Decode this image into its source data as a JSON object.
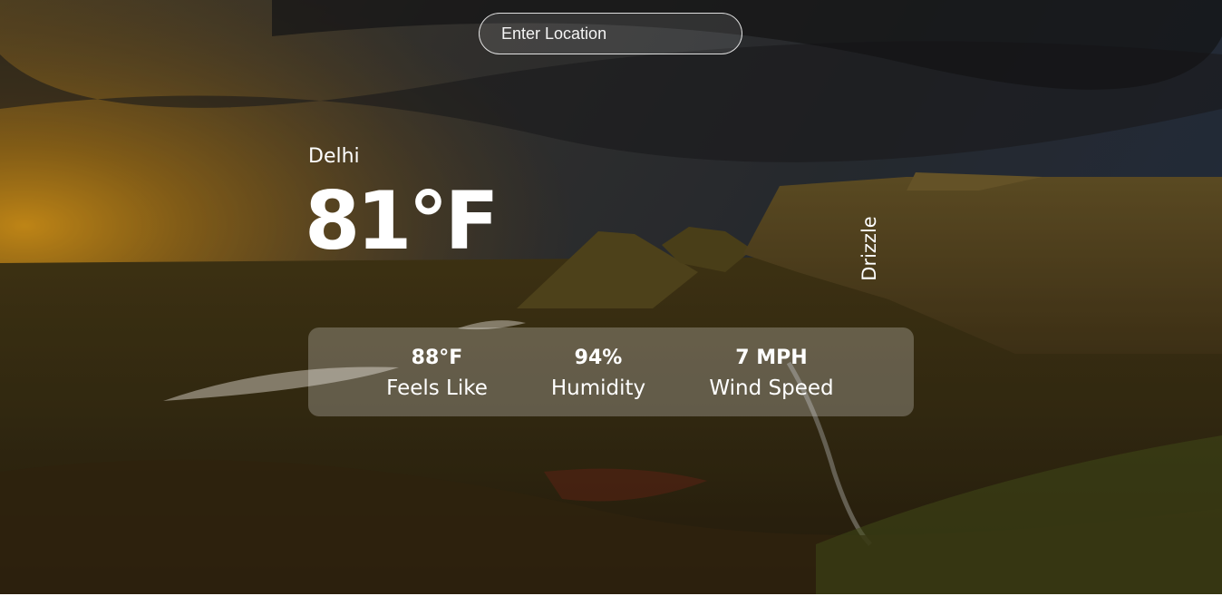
{
  "search": {
    "placeholder": "Enter Location"
  },
  "weather": {
    "location": "Delhi",
    "temperature": "81°F",
    "condition": "Drizzle"
  },
  "details": [
    {
      "value": "88°F",
      "label": "Feels Like"
    },
    {
      "value": "94%",
      "label": "Humidity"
    },
    {
      "value": "7 MPH",
      "label": "Wind Speed"
    }
  ]
}
